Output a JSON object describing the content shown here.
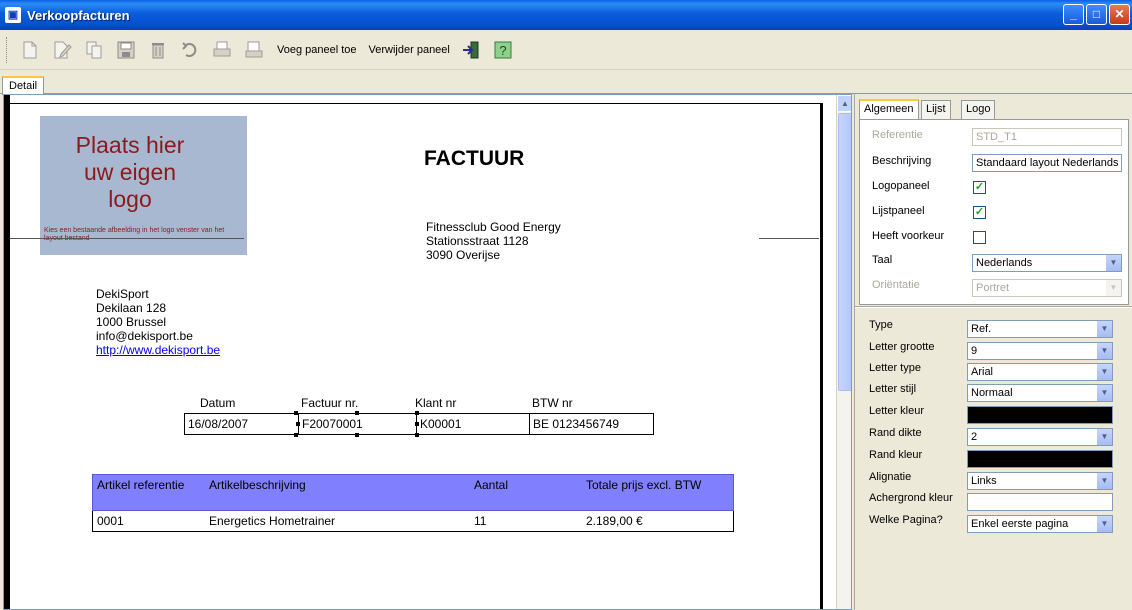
{
  "window": {
    "title": "Verkoopfacturen",
    "colors": {
      "titlebar": "#0a5cdc",
      "close": "#c43b16"
    }
  },
  "toolbar": {
    "add_panel_label": "Voeg paneel toe",
    "remove_panel_label": "Verwijder paneel",
    "icons": [
      "new-doc-icon",
      "edit-icon",
      "copy-icon",
      "save-icon",
      "delete-icon",
      "undo-icon",
      "print-icon",
      "print-preview-icon",
      "exit-icon",
      "help-icon"
    ]
  },
  "tabs": {
    "detail": "Detail"
  },
  "document": {
    "logo": {
      "line1": "Plaats hier",
      "line2": "uw eigen",
      "line3": "logo",
      "hint": "Kies een bestaande afbeelding in het logo venster van het layout bestand"
    },
    "title": "FACTUUR",
    "company": {
      "name": "Fitnessclub Good Energy",
      "street": "Stationsstraat 1128",
      "city": "3090 Overijse"
    },
    "customer": {
      "name": "DekiSport",
      "street": "Dekilaan 128",
      "city": "1000 Brussel",
      "email": "info@dekisport.be",
      "website": "http://www.dekisport.be"
    },
    "info": {
      "labels": {
        "date": "Datum",
        "invoice_nr": "Factuur nr.",
        "client_nr": "Klant nr",
        "vat_nr": "BTW nr"
      },
      "values": {
        "date": "16/08/2007",
        "invoice_nr": "F20070001",
        "client_nr": "K00001",
        "vat_nr": "BE 0123456749"
      }
    },
    "articles": {
      "headers": {
        "ref": "Artikel referentie",
        "desc": "Artikelbeschrijving",
        "qty": "Aantal",
        "total": "Totale prijs excl. BTW"
      },
      "rows": [
        {
          "ref": "0001",
          "desc": "Energetics Hometrainer",
          "qty": "11",
          "total": "2.189,00 €"
        }
      ],
      "header_color": "#8080ff"
    }
  },
  "panel": {
    "tabs": {
      "general": "Algemeen",
      "list": "Lijst",
      "logo": "Logo"
    },
    "general": {
      "reference_label": "Referentie",
      "reference_value": "STD_T1",
      "description_label": "Beschrijving",
      "description_value": "Standaard layout Nederlands",
      "logopanel_label": "Logopaneel",
      "logopanel_checked": "✓",
      "listpanel_label": "Lijstpaneel",
      "listpanel_checked": "✓",
      "preference_label": "Heeft voorkeur",
      "preference_checked": "",
      "language_label": "Taal",
      "language_value": "Nederlands",
      "orientation_label": "Oriëntatie",
      "orientation_value": "Portret"
    },
    "properties": {
      "type_label": "Type",
      "type_value": "Ref.",
      "fontsize_label": "Letter grootte",
      "fontsize_value": "9",
      "fonttype_label": "Letter type",
      "fonttype_value": "Arial",
      "fontstyle_label": "Letter stijl",
      "fontstyle_value": "Normaal",
      "fontcolor_label": "Letter kleur",
      "fontcolor_value": "#000000",
      "border_label": "Rand dikte",
      "border_value": "2",
      "bordercolor_label": "Rand kleur",
      "bordercolor_value": "#000000",
      "align_label": "Alignatie",
      "align_value": "Links",
      "bg_label": "Achergrond kleur",
      "bg_value": "#ffffff",
      "page_label": "Welke Pagina?",
      "page_value": "Enkel eerste pagina"
    }
  }
}
